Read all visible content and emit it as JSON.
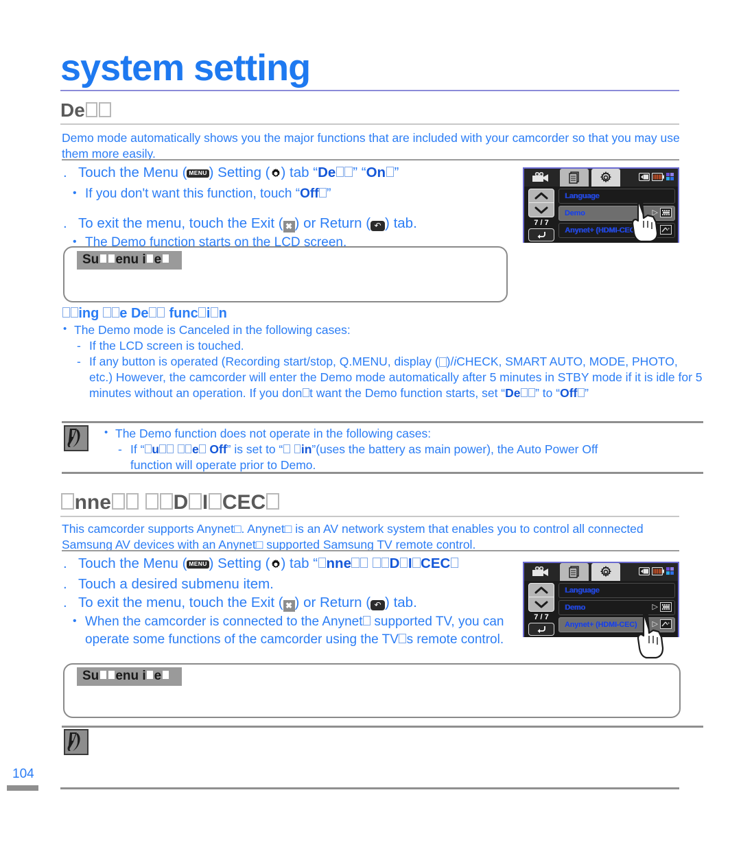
{
  "document": {
    "chapter_title": "system setting",
    "page_number": "104"
  },
  "section_demo": {
    "heading_text": "De",
    "heading_missing_glyphs": 2,
    "intro": "Demo mode automatically shows you the major functions that are included with your camcorder so that you may use them more easily.",
    "steps": [
      {
        "num": ".",
        "pre": "Touch the Menu (",
        "icon1": "MENU",
        "mid1": ")    Setting (",
        "icon2": "gear",
        "mid2": ") tab    “",
        "kw1": "De",
        "mid3": "”    “",
        "kw2": "On",
        "post": "”"
      }
    ],
    "sub_items": [
      "If you don't want this function, touch “Off”"
    ],
    "exit_step": {
      "num": ".",
      "pre": "To exit the menu, touch the Exit (",
      "icon_exit": "✖",
      "mid": ") or Return (",
      "icon_return": "↶",
      "post": ") tab."
    },
    "exit_sub": "The Demo function starts on the LCD screen.",
    "submenu_label": "Su",
    "submenu_label_2": "enu i",
    "submenu_label_3": "e",
    "using_heading_a": "ing ",
    "using_heading_b": "e De",
    "using_heading_c": " func",
    "using_heading_d": "i",
    "using_heading_e": "n",
    "canceled_intro": "The Demo mode is Canceled in the following cases:",
    "canceled_items": [
      "If the LCD screen is touched.",
      "If any button is operated (Recording start/stop, Q.MENU, display (□)/iCHECK, SMART AUTO, MODE, PHOTO, etc.) However, the camcorder will enter the Demo mode automatically after 5 minutes in STBY mode if it is idle for 5 minutes without an operation. If you don□t want the Demo function starts, set “De□□” to “Off□”"
    ],
    "note": {
      "line1": "The Demo function does not operate in the following cases:",
      "line2_a": "If “",
      "line2_kw1": "u",
      "line2_kw1b": "e",
      "line2_kw1c": "Off",
      "line2_b": "” is set to “",
      "line2_kw2": "in",
      "line2_c": "”(uses the battery as main power), the Auto Power Off",
      "line3": "function will operate prior to Demo."
    }
  },
  "section_anynet": {
    "heading_a": "nne",
    "heading_b": "D",
    "heading_c": "I",
    "heading_d": "CEC",
    "intro": "This camcorder supports Anynet□. Anynet□ is an AV network system that enables you to control all connected Samsung AV devices with an Anynet□ supported Samsung TV remote control.",
    "step1_pre": "Touch the Menu (",
    "step1_icon1": "MENU",
    "step1_mid1": ")    Setting (",
    "step1_mid2": ") tab    “",
    "step1_kw_a": "nne",
    "step1_kw_b": "D",
    "step1_kw_c": "I",
    "step1_kw_d": "CEC",
    "step2": "Touch a desired submenu item.",
    "step3_pre": "To exit the menu, touch the Exit (",
    "step3_mid": ") or Return (",
    "step3_post": ") tab.",
    "step3_sub": "When the camcorder is connected to the Anynet□ supported TV, you can operate some functions of the camcorder using the TV□s remote control.",
    "submenu_label": "Su",
    "submenu_label_2": "enu i",
    "submenu_label_3": "e"
  },
  "lcd_top": {
    "tabs": [
      "camcorder-tab",
      "file-tab",
      "settings-tab"
    ],
    "status_icons": [
      "memory-card",
      "battery",
      "signal"
    ],
    "page_indicator": "7 / 7",
    "nav_up": "∧",
    "nav_down": "∨",
    "return": "↶",
    "rows": [
      {
        "label": "Language",
        "highlighted": false,
        "has_arrow": false,
        "badge": ""
      },
      {
        "label": "Demo",
        "highlighted": true,
        "has_arrow": true,
        "badge": "DEMO"
      },
      {
        "label": "Anynet+ (HDMI-CEC)",
        "highlighted": false,
        "has_arrow": true,
        "badge": "A+"
      }
    ],
    "touch_target_row": 1
  },
  "lcd_bottom": {
    "page_indicator": "7 / 7",
    "nav_up": "∧",
    "nav_down": "∨",
    "return": "↶",
    "rows": [
      {
        "label": "Language",
        "highlighted": false,
        "has_arrow": false,
        "badge": ""
      },
      {
        "label": "Demo",
        "highlighted": false,
        "has_arrow": true,
        "badge": "DEMO"
      },
      {
        "label": "Anynet+ (HDMI-CEC)",
        "highlighted": true,
        "has_arrow": true,
        "badge": "A+"
      }
    ],
    "touch_target_row": 2
  },
  "colors": {
    "title_blue": "#1E79F0",
    "body_blue": "#2B7DF5",
    "keyword_blue": "#1457D8",
    "heading_gray": "#5A5A5A",
    "rule_gray": "#8f8f8f",
    "lcd_border": "#6a6ad0"
  }
}
